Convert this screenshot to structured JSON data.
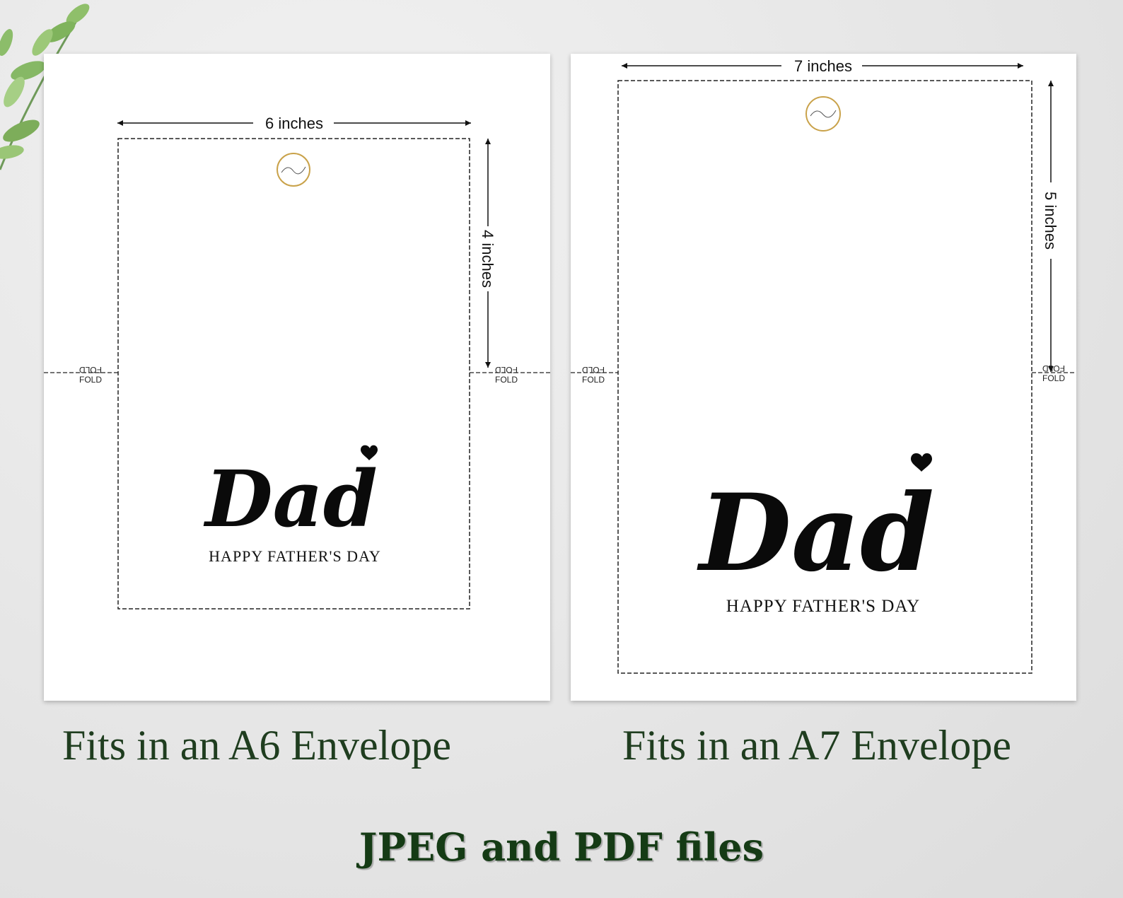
{
  "decor": {
    "leaves_icon": "eucalyptus-leaves-icon"
  },
  "cards": [
    {
      "width_label": "6 inches",
      "height_label": "4 inches",
      "fold_label": "FOLD",
      "card_title": "Dad",
      "greeting": "HAPPY FATHER'S DAY",
      "caption": "Fits in an A6 Envelope"
    },
    {
      "width_label": "7 inches",
      "height_label": "5 inches",
      "fold_label": "FOLD",
      "card_title": "Dad",
      "greeting": "HAPPY FATHER'S DAY",
      "caption": "Fits in an A7 Envelope"
    }
  ],
  "footer": {
    "formats": "JPEG and PDF files"
  },
  "colors": {
    "caption_green": "#1f3d1f",
    "footer_green": "#153b15",
    "logo_gold": "#c9a24a"
  }
}
